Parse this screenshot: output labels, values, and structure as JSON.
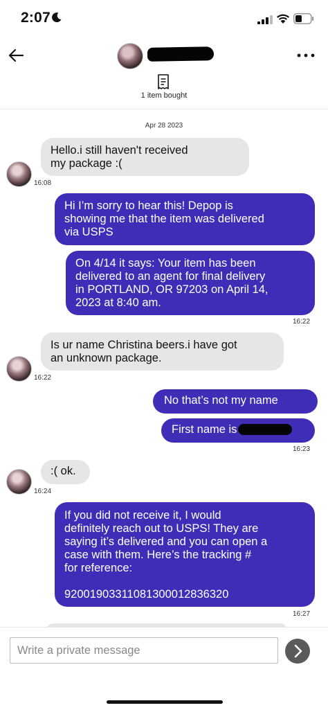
{
  "status": {
    "time": "2:07"
  },
  "header": {
    "items_bought": "1 item bought"
  },
  "chat": {
    "date": "Apr 28 2023",
    "messages": [
      {
        "dir": "in",
        "line1": "Hello.i still haven't received",
        "line2": "my package :(",
        "time": "16:08"
      },
      {
        "dir": "out",
        "line1": "Hi I’m sorry to hear this! Depop is",
        "line2": "showing me that the item was delivered",
        "line3": "via USPS"
      },
      {
        "dir": "out",
        "line1": "On 4/14 it says: Your item has been",
        "line2": "delivered to an agent for final delivery",
        "line3": "in PORTLAND, OR 97203 on April 14,",
        "line4": "2023 at 8:40 am.",
        "time": "16:22"
      },
      {
        "dir": "in",
        "line1": "Is ur name Christina beers.i have got",
        "line2": "an unknown package.",
        "time": "16:22"
      },
      {
        "dir": "out",
        "text": "No that’s not my name"
      },
      {
        "dir": "out",
        "text": "First name is",
        "time": "16:23"
      },
      {
        "dir": "in",
        "text": ":( ok.",
        "time": "16:24"
      },
      {
        "dir": "out",
        "line1": "If you did not receive it, I would",
        "line2": "definitely reach out to USPS! They are",
        "line3": "saying it’s delivered and you can open a",
        "line4": "case with them. Here’s the tracking #",
        "line5": "for reference:",
        "tracking": "9200190331108130001283632​0",
        "time": "16:27"
      }
    ]
  },
  "composer": {
    "placeholder": "Write a private message"
  },
  "colors": {
    "outgoing": "#3f2db8",
    "incoming": "#e6e6e6",
    "send_button": "#5a5a5a"
  }
}
